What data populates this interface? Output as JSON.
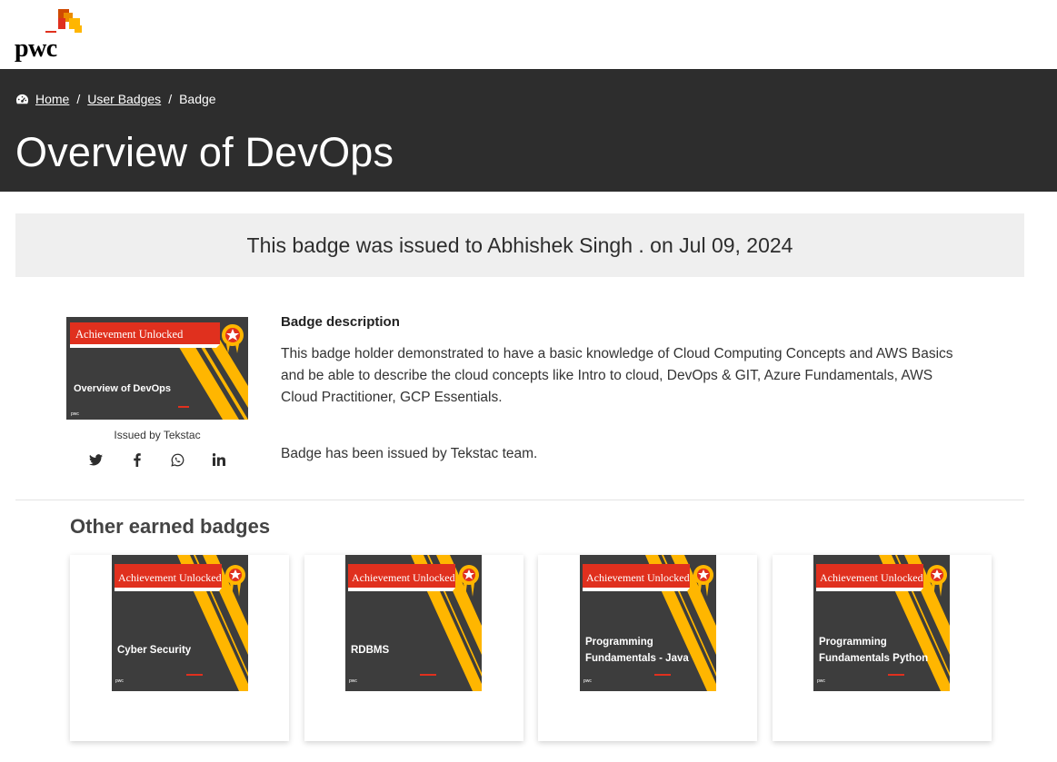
{
  "brand": {
    "logo_text": "pwc"
  },
  "breadcrumb": {
    "home": "Home",
    "user_badges": "User Badges",
    "current": "Badge"
  },
  "page": {
    "title": "Overview of DevOps"
  },
  "banner": {
    "text": "This badge was issued to Abhishek Singh . on Jul 09, 2024"
  },
  "badge": {
    "ribbon": "Achievement Unlocked",
    "name": "Overview of DevOps",
    "issued_by": "Issued by Tekstac",
    "share_icons": [
      "twitter-icon",
      "facebook-icon",
      "whatsapp-icon",
      "linkedin-icon"
    ]
  },
  "description": {
    "title": "Badge description",
    "text": "This badge holder demonstrated to have a basic knowledge of Cloud Computing Concepts and AWS Basics and be able to describe the cloud concepts like Intro to cloud, DevOps & GIT, Azure Fundamentals, AWS Cloud Practitioner, GCP Essentials.",
    "issued_note": "Badge has been issued by Tekstac team."
  },
  "other_badges": {
    "title": "Other earned badges",
    "items": [
      {
        "ribbon": "Achievement Unlocked",
        "line1": "Cyber Security",
        "line2": ""
      },
      {
        "ribbon": "Achievement Unlocked",
        "line1": "RDBMS",
        "line2": ""
      },
      {
        "ribbon": "Achievement Unlocked",
        "line1": "Programming",
        "line2": "Fundamentals - Java"
      },
      {
        "ribbon": "Achievement Unlocked",
        "line1": "Programming",
        "line2": "Fundamentals Python"
      }
    ]
  },
  "colors": {
    "hero_bg": "#2d2d2d",
    "badge_bg": "#3d3d3d",
    "ribbon_red": "#e0301e",
    "stripe_yellow": "#ffb600",
    "accent_orange": "#d04a02"
  }
}
